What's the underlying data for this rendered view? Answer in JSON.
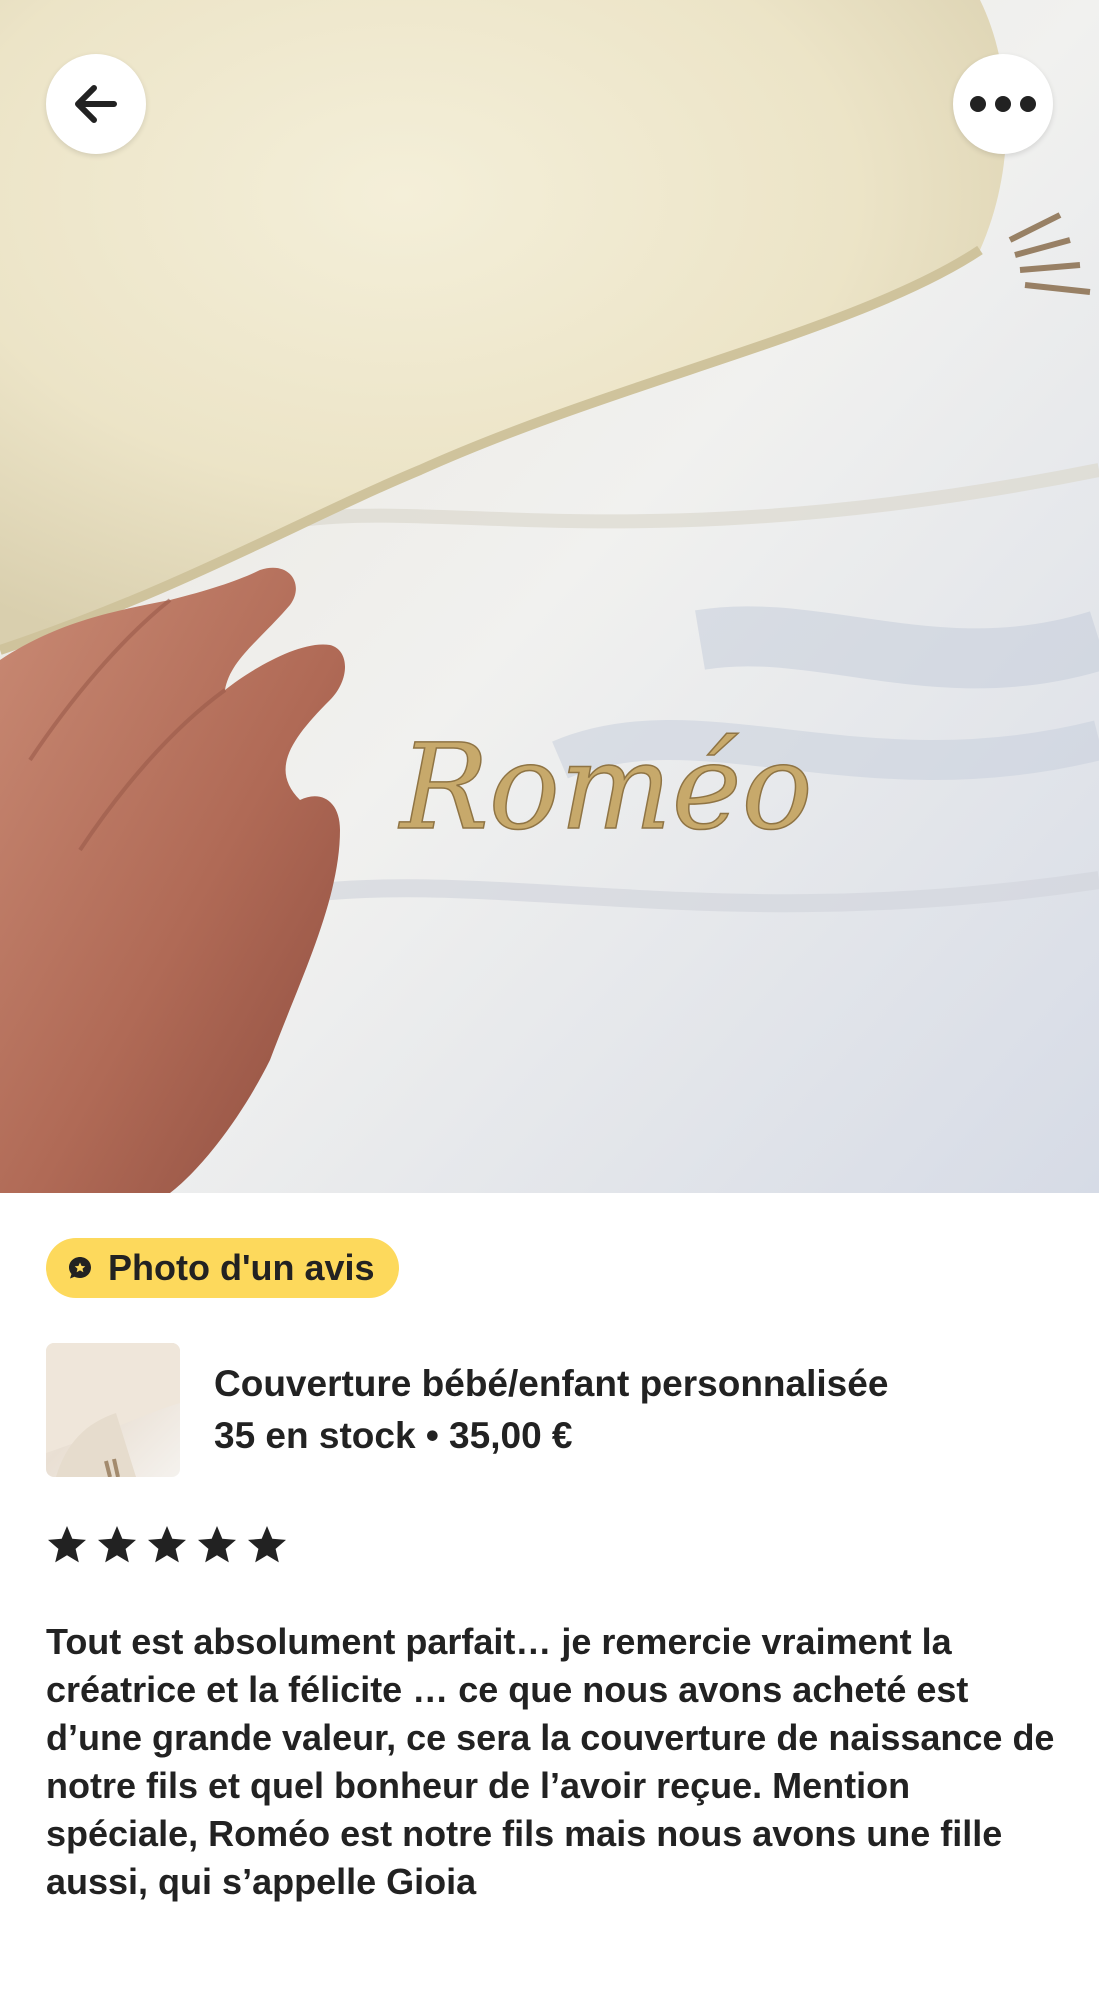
{
  "photo": {
    "embroidered_name": "Roméo",
    "back_icon": "arrow-left-icon",
    "more_icon": "more-horizontal-icon"
  },
  "badge": {
    "label": "Photo d'un avis",
    "icon": "review-bubble-icon",
    "color": "#fdd95c"
  },
  "product": {
    "title": "Couverture bébé/enfant personnalisée",
    "meta": "35 en stock • 35,00 €"
  },
  "review": {
    "rating": 5,
    "max_rating": 5,
    "text": "Tout est absolument parfait… je remercie vraiment la créatrice et la félicite … ce que nous avons acheté est d’une grande valeur, ce sera la couverture de naissance de notre fils et quel bonheur de l’avoir reçue. Mention spéciale, Roméo est notre fils mais nous avons une fille aussi, qui s’appelle Gioia"
  }
}
